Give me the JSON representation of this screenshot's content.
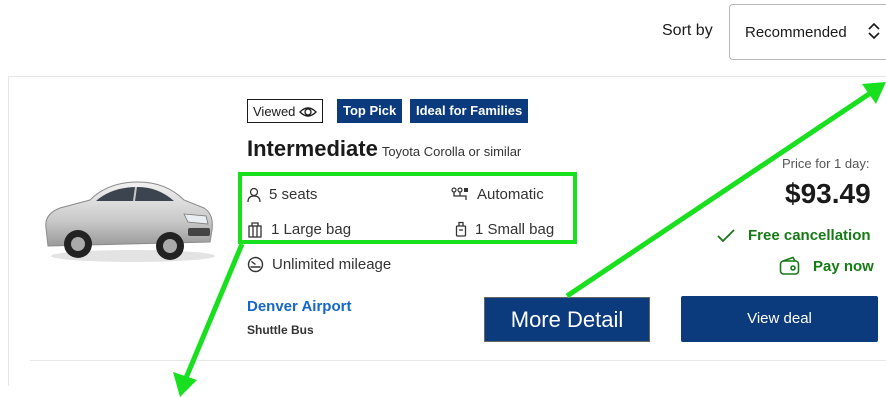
{
  "sort": {
    "label": "Sort by",
    "selected": "Recommended"
  },
  "listing": {
    "badges": {
      "viewed": "Viewed",
      "top_pick": "Top Pick",
      "families": "Ideal for Families"
    },
    "category": "Intermediate",
    "model": "Toyota Corolla or similar",
    "features": {
      "seats": "5 seats",
      "transmission": "Automatic",
      "large_bag": "1 Large bag",
      "small_bag": "1 Small bag",
      "mileage": "Unlimited mileage"
    },
    "pickup": {
      "location": "Denver Airport",
      "type": "Shuttle Bus"
    },
    "price": {
      "label": "Price for 1 day:",
      "amount": "$93.49"
    },
    "perks": {
      "cancellation": "Free cancellation",
      "payment": "Pay now"
    },
    "actions": {
      "more_detail": "More Detail",
      "view_deal": "View deal"
    }
  },
  "colors": {
    "brand": "#0b3a7d",
    "link": "#1467c4",
    "positive": "#167a16",
    "annotation": "#18e01e"
  },
  "icons": [
    "eye-icon",
    "person-icon",
    "gear-shift-icon",
    "luggage-icon",
    "small-bag-icon",
    "speedometer-icon",
    "check-icon",
    "wallet-icon",
    "chevron-updown-icon"
  ]
}
